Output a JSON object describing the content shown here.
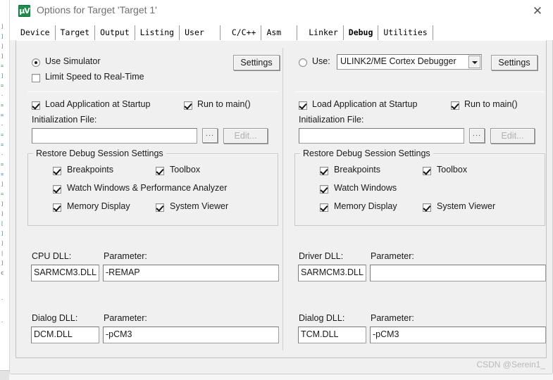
{
  "window": {
    "title": "Options for Target 'Target 1'",
    "icon": "uvision-icon",
    "icon_glyph": "µV",
    "close_label": "✕"
  },
  "tabs": [
    {
      "label": "Device",
      "active": false
    },
    {
      "label": "Target",
      "active": false
    },
    {
      "label": "Output",
      "active": false
    },
    {
      "label": "Listing",
      "active": false
    },
    {
      "label": "User",
      "active": false
    },
    {
      "label": "C/C++",
      "active": false
    },
    {
      "label": "Asm",
      "active": false
    },
    {
      "label": "Linker",
      "active": false
    },
    {
      "label": "Debug",
      "active": true
    },
    {
      "label": "Utilities",
      "active": false
    }
  ],
  "left_panel": {
    "use_simulator": {
      "label": "Use Simulator",
      "checked": true
    },
    "limit_speed": {
      "label": "Limit Speed to Real-Time",
      "checked": false
    },
    "settings_button": "Settings",
    "load_application": {
      "label": "Load Application at Startup",
      "checked": true
    },
    "run_to_main": {
      "label": "Run to main()",
      "checked": true
    },
    "init_file_label": "Initialization File:",
    "init_file_value": "",
    "init_file_placeholder": "",
    "browse_button": "...",
    "edit_button": "Edit...",
    "restore_group": {
      "title": "Restore Debug Session Settings",
      "items": [
        {
          "label": "Breakpoints",
          "checked": true
        },
        {
          "label": "Toolbox",
          "checked": true
        },
        {
          "label": "Watch Windows & Performance Analyzer",
          "checked": true
        },
        {
          "label": "Memory Display",
          "checked": true
        },
        {
          "label": "System Viewer",
          "checked": true
        }
      ]
    },
    "cpu_dll_label": "CPU DLL:",
    "cpu_dll_value": "SARMCM3.DLL",
    "cpu_param_label": "Parameter:",
    "cpu_param_value": "-REMAP",
    "dialog_dll_label": "Dialog DLL:",
    "dialog_dll_value": "DCM.DLL",
    "dialog_param_label": "Parameter:",
    "dialog_param_value": "-pCM3"
  },
  "right_panel": {
    "use_label": "Use:",
    "use_checked": false,
    "debugger_selected": "ULINK2/ME Cortex Debugger",
    "settings_button": "Settings",
    "load_application": {
      "label": "Load Application at Startup",
      "checked": true
    },
    "run_to_main": {
      "label": "Run to main()",
      "checked": true
    },
    "init_file_label": "Initialization File:",
    "init_file_value": "",
    "browse_button": "...",
    "edit_button": "Edit...",
    "restore_group": {
      "title": "Restore Debug Session Settings",
      "items": [
        {
          "label": "Breakpoints",
          "checked": true
        },
        {
          "label": "Toolbox",
          "checked": true
        },
        {
          "label": "Watch Windows",
          "checked": true
        },
        {
          "label": "Memory Display",
          "checked": true
        },
        {
          "label": "System Viewer",
          "checked": true
        }
      ]
    },
    "driver_dll_label": "Driver DLL:",
    "driver_dll_value": "SARMCM3.DLL",
    "driver_param_label": "Parameter:",
    "driver_param_value": "",
    "dialog_dll_label": "Dialog DLL:",
    "dialog_dll_value": "TCM.DLL",
    "dialog_param_label": "Parameter:",
    "dialog_param_value": "-pCM3"
  },
  "watermark": "CSDN @Serein1_",
  "colors": {
    "dialog_bg": "#f0f0f0",
    "titlebar_bg": "#ffffff",
    "accent_green": "#1f8b4c",
    "text": "#1a1a1a",
    "disabled_text": "#b0b0b0",
    "watermark": "#b9b9b9"
  }
}
